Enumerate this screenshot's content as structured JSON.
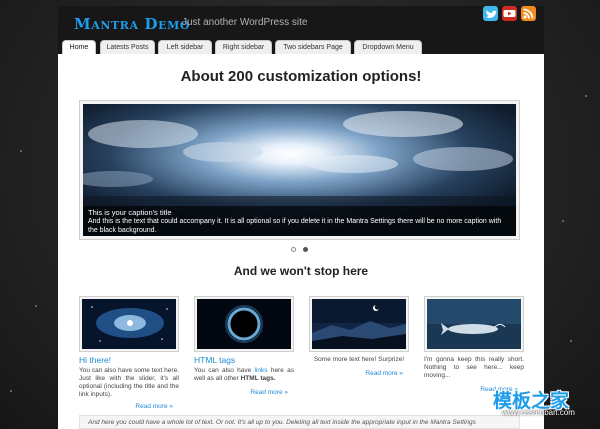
{
  "header": {
    "site_title": "Mantra Demo",
    "tagline": "Just another WordPress site",
    "social_icons": [
      "twitter-icon",
      "youtube-icon",
      "rss-icon"
    ]
  },
  "nav": {
    "items": [
      {
        "label": "Home",
        "active": true
      },
      {
        "label": "Latests Posts"
      },
      {
        "label": "Left sidebar"
      },
      {
        "label": "Right sidebar"
      },
      {
        "label": "Two sidebars Page"
      },
      {
        "label": "Dropdown Menu"
      }
    ]
  },
  "main": {
    "heading": "About 200 customization options!",
    "slider": {
      "caption_title": "This is your caption's title",
      "caption_text": "And this is the text that could accompany it. It is all optional so if you delete it in the Mantra Settings there will be no more caption with the black background.",
      "dots": 2,
      "active_dot": 1
    },
    "subheading": "And we won't stop here",
    "columns": [
      {
        "title": "Hi there!",
        "text": "You can also have some text here. Just like with the slider, it's all optional (including the title and the link inputs).",
        "read_more": "Read more »"
      },
      {
        "title": "HTML tags",
        "text_before": "You can also have ",
        "link": "links",
        "text_middle": " here as well as all other ",
        "bold": "HTML tags.",
        "read_more": "Read more »"
      },
      {
        "title": "",
        "text": "Some more text here! Surprize!",
        "read_more": "Read more »"
      },
      {
        "title": "",
        "text": "I'm gonna keep this really short. Nothing to see here... keep moving...",
        "read_more": "Read more »"
      }
    ],
    "bottom_text": "And here you could have a whole lot of text. Or not. It's all up to you. Deleting all text inside the appropriate input in the Mantra Settings"
  },
  "watermark": {
    "text": "模板之家",
    "url": "www.cssmoban.com"
  },
  "colors": {
    "accent": "#1e9ce8",
    "header_bg": "#171717",
    "page_bg": "#ffffff"
  }
}
